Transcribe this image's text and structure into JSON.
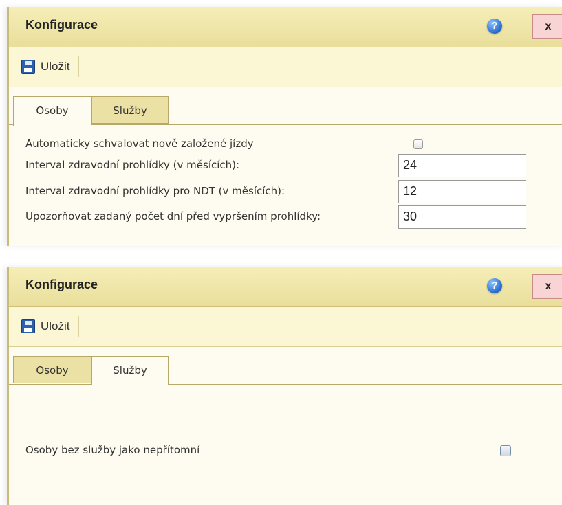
{
  "panels": [
    {
      "title": "Konfigurace",
      "help_label": "?",
      "close_label": "x",
      "toolbar": {
        "save_label": "Uložit"
      },
      "tabs": [
        "Osoby",
        "Služby"
      ],
      "active_tab": "Osoby",
      "fields": {
        "auto_approve_label": "Automaticky schvalovat nově založené jízdy",
        "auto_approve_checked": false,
        "medical_interval_label": "Interval zdravodní prohlídky (v měsících):",
        "medical_interval_value": "24",
        "medical_interval_ndt_label": "Interval zdravodní prohlídky pro NDT (v měsících):",
        "medical_interval_ndt_value": "12",
        "notify_days_label": "Upozorňovat zadaný počet dní před vypršením prohlídky:",
        "notify_days_value": "30"
      }
    },
    {
      "title": "Konfigurace",
      "help_label": "?",
      "close_label": "x",
      "toolbar": {
        "save_label": "Uložit"
      },
      "tabs": [
        "Osoby",
        "Služby"
      ],
      "active_tab": "Služby",
      "fields": {
        "absent_without_service_label": "Osoby bez služby jako nepřítomní",
        "absent_without_service_checked": false
      }
    }
  ],
  "colors": {
    "titlebar": "#ebe1a2",
    "tab_inactive": "#ece1a4",
    "content_bg": "#fefcf0",
    "close_button": "#f8d4d4",
    "help_button": "#2b6fd0"
  },
  "icons": [
    "save-icon",
    "help-icon",
    "close-icon"
  ]
}
